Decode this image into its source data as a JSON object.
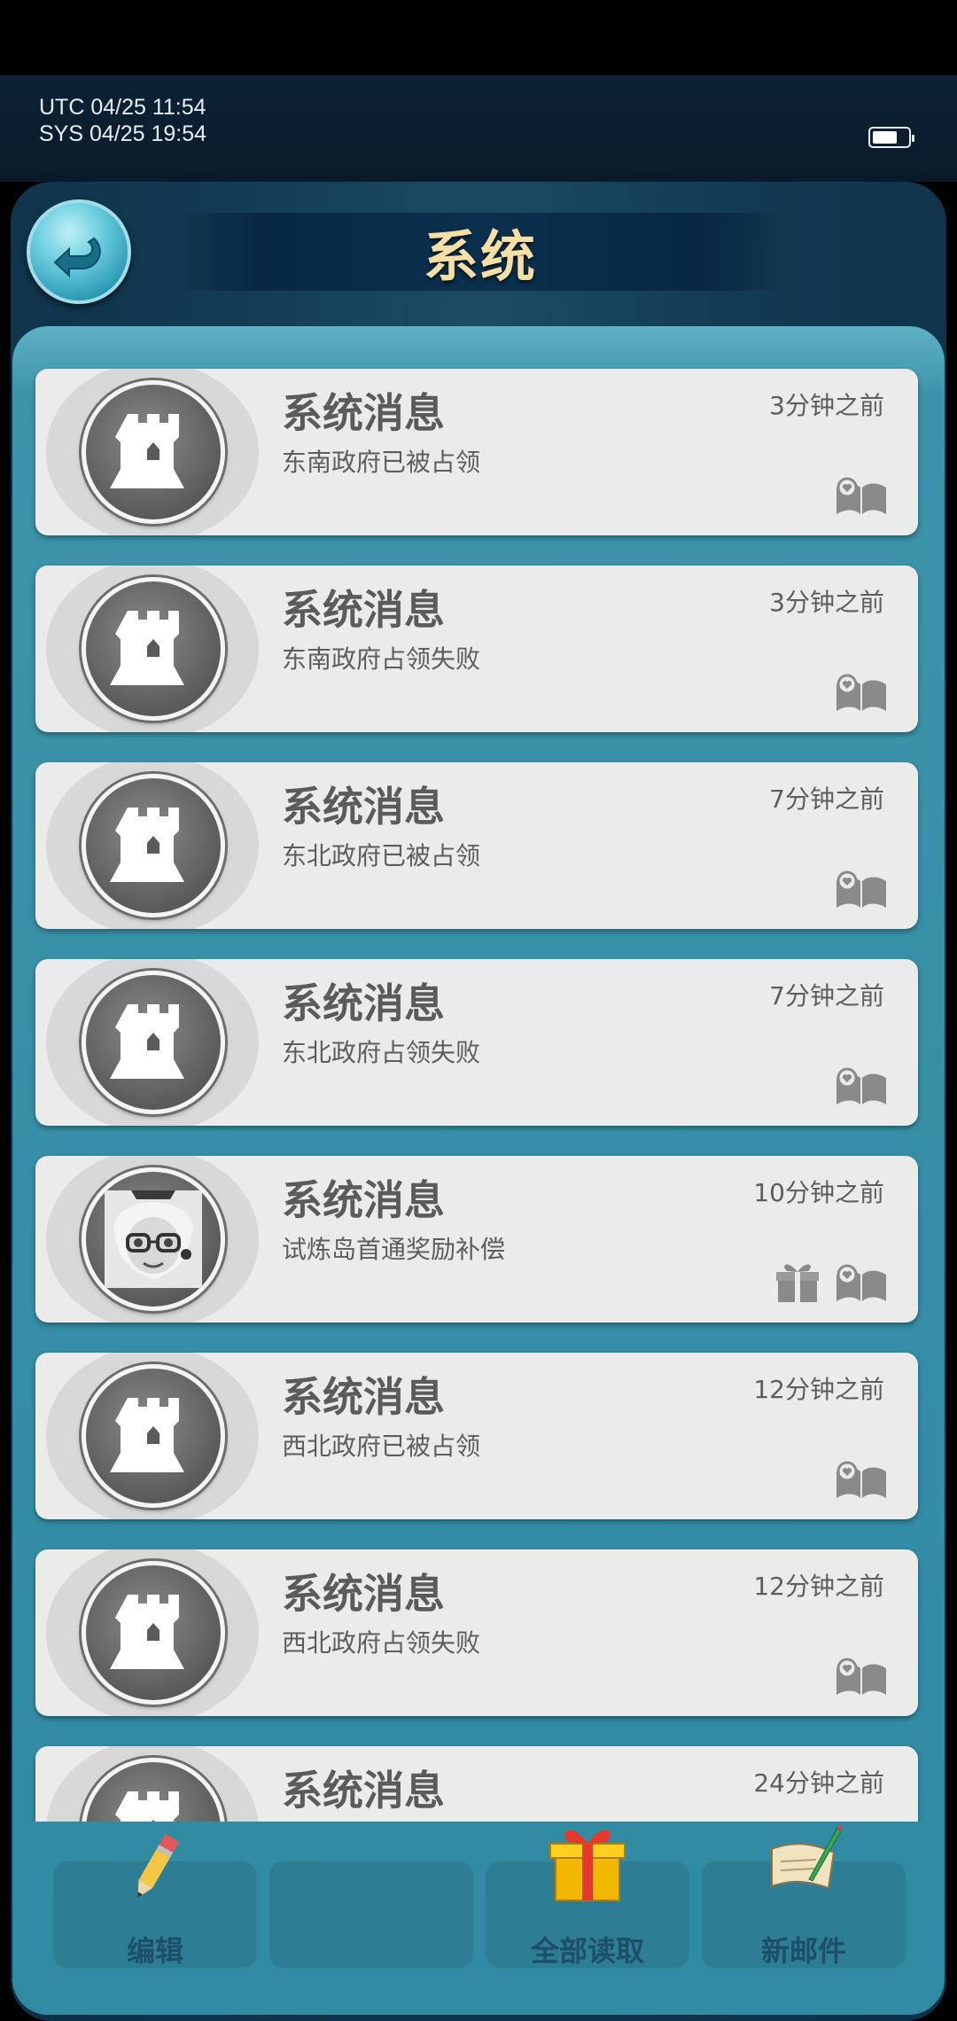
{
  "status": {
    "utc": "UTC 04/25 11:54",
    "sys": "SYS 04/25 19:54"
  },
  "header": {
    "title": "系统"
  },
  "messages": [
    {
      "title": "系统消息",
      "subtitle": "东南政府已被占领",
      "time": "3分钟之前",
      "avatar": "tower-icon",
      "gift": false
    },
    {
      "title": "系统消息",
      "subtitle": "东南政府占领失败",
      "time": "3分钟之前",
      "avatar": "tower-icon",
      "gift": false
    },
    {
      "title": "系统消息",
      "subtitle": "东北政府已被占领",
      "time": "7分钟之前",
      "avatar": "tower-icon",
      "gift": false
    },
    {
      "title": "系统消息",
      "subtitle": "东北政府占领失败",
      "time": "7分钟之前",
      "avatar": "tower-icon",
      "gift": false
    },
    {
      "title": "系统消息",
      "subtitle": "试炼岛首通奖励补偿",
      "time": "10分钟之前",
      "avatar": "girl-portrait",
      "gift": true
    },
    {
      "title": "系统消息",
      "subtitle": "西北政府已被占领",
      "time": "12分钟之前",
      "avatar": "tower-icon",
      "gift": false
    },
    {
      "title": "系统消息",
      "subtitle": "西北政府占领失败",
      "time": "12分钟之前",
      "avatar": "tower-icon",
      "gift": false
    },
    {
      "title": "系统消息",
      "subtitle": "",
      "time": "24分钟之前",
      "avatar": "tower-icon",
      "gift": false
    }
  ],
  "toolbar": {
    "edit_label": "编辑",
    "empty_label": "",
    "read_all_label": "全部读取",
    "new_mail_label": "新邮件"
  }
}
